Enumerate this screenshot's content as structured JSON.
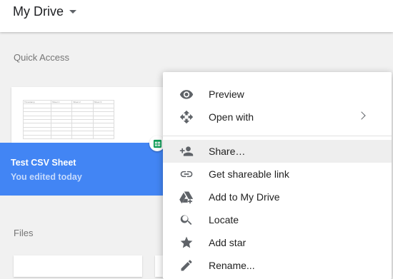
{
  "header": {
    "title": "My Drive"
  },
  "sections": {
    "quick_access": "Quick Access",
    "files": "Files"
  },
  "quick_access_card": {
    "name": "Test CSV Sheet",
    "subtitle": "You edited today",
    "icon": "google-sheets-icon",
    "accent_color": "#4285f4"
  },
  "context_menu": {
    "items": [
      {
        "label": "Preview",
        "icon": "eye-icon"
      },
      {
        "label": "Open with",
        "icon": "move-arrows-icon",
        "submenu": true
      },
      {
        "label": "Share…",
        "icon": "add-person-icon",
        "highlighted": true
      },
      {
        "label": "Get shareable link",
        "icon": "link-icon"
      },
      {
        "label": "Add to My Drive",
        "icon": "drive-add-icon"
      },
      {
        "label": "Locate",
        "icon": "search-icon"
      },
      {
        "label": "Add star",
        "icon": "star-icon"
      },
      {
        "label": "Rename...",
        "icon": "pencil-icon"
      }
    ]
  }
}
